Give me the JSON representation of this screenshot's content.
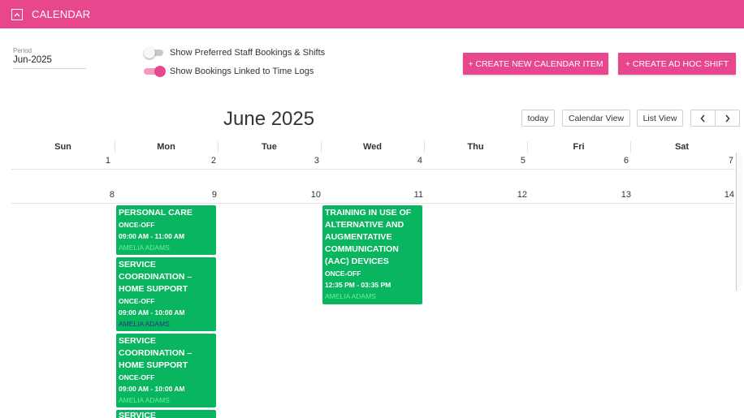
{
  "header": {
    "title": "CALENDAR",
    "collapse_icon": "chevron-up-icon"
  },
  "period": {
    "label": "Period",
    "value": "Jun-2025"
  },
  "toggles": [
    {
      "label": "Show Preferred Staff Bookings & Shifts",
      "on": false
    },
    {
      "label": "Show Bookings Linked to Time Logs",
      "on": true
    }
  ],
  "actions": {
    "create_calendar_item": "+ CREATE NEW CALENDAR ITEM",
    "create_ad_hoc_shift": "+ CREATE AD HOC SHIFT"
  },
  "calendar": {
    "title": "June 2025",
    "today_label": "today",
    "calendar_view_label": "Calendar View",
    "list_view_label": "List View",
    "prev_icon": "chevron-left-icon",
    "next_icon": "chevron-right-icon",
    "days": [
      "Sun",
      "Mon",
      "Tue",
      "Wed",
      "Thu",
      "Fri",
      "Sat"
    ],
    "weeks": [
      [
        "1",
        "2",
        "3",
        "4",
        "5",
        "6",
        "7"
      ],
      [
        "8",
        "9",
        "10",
        "11",
        "12",
        "13",
        "14"
      ]
    ],
    "events": [
      {
        "day": "Mon",
        "title": "PERSONAL CARE",
        "type": "ONCE-OFF",
        "time": "09:00 AM - 11:00 AM",
        "person": "AMELIA ADAMS"
      },
      {
        "day": "Mon",
        "title": "SERVICE COORDINATION – HOME SUPPORT",
        "type": "ONCE-OFF",
        "time": "09:00 AM - 10:00 AM",
        "person": "AMELIA ADAMS"
      },
      {
        "day": "Mon",
        "title": "SERVICE COORDINATION – HOME SUPPORT",
        "type": "ONCE-OFF",
        "time": "09:00 AM - 10:00 AM",
        "person": "AMELIA ADAMS"
      },
      {
        "day": "Mon",
        "title": "SERVICE",
        "type": "",
        "time": "",
        "person": ""
      },
      {
        "day": "Wed",
        "title": "TRAINING IN USE OF ALTERNATIVE AND AUGMENTATIVE COMMUNICATION (AAC) DEVICES",
        "type": "ONCE-OFF",
        "time": "12:35 PM - 03:35 PM",
        "person": "AMELIA ADAMS"
      }
    ]
  },
  "colors": {
    "brand": "#e8478e",
    "event": "#0ab55f",
    "person_text": "#5ff59a",
    "person_text_alt": "#1c3d7a"
  }
}
